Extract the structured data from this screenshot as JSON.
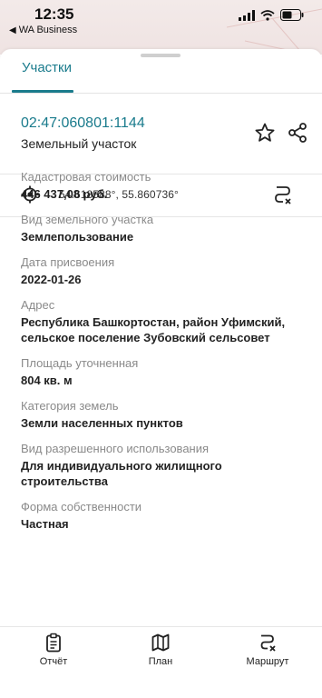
{
  "status_bar": {
    "time": "12:35",
    "back_app": "WA Business"
  },
  "tabs": [
    {
      "label": "Участки",
      "active": true
    }
  ],
  "parcel": {
    "cadastral_number": "02:47:060801:1144",
    "type": "Земельный участок",
    "coordinates": "54.618588°, 55.860736°"
  },
  "properties": [
    {
      "label": "Кадастровая стоимость",
      "value": "446 437,08 руб."
    },
    {
      "label": "Вид земельного участка",
      "value": "Землепользование"
    },
    {
      "label": "Дата присвоения",
      "value": "2022-01-26"
    },
    {
      "label": "Адрес",
      "value": "Республика Башкортостан, район Уфимский, сельское поселение Зубовский сельсовет"
    },
    {
      "label": "Площадь уточненная",
      "value": "804 кв. м"
    },
    {
      "label": "Категория земель",
      "value": "Земли населенных пунктов"
    },
    {
      "label": "Вид разрешенного использования",
      "value": "Для индивидуального жилищного строительства"
    },
    {
      "label": "Форма собственности",
      "value": "Частная"
    }
  ],
  "bottom_nav": [
    {
      "label": "Отчёт",
      "icon": "report-icon"
    },
    {
      "label": "План",
      "icon": "map-icon"
    },
    {
      "label": "Маршрут",
      "icon": "route-icon"
    }
  ],
  "colors": {
    "accent": "#1a7b8c",
    "label_gray": "#8a8a8a"
  }
}
